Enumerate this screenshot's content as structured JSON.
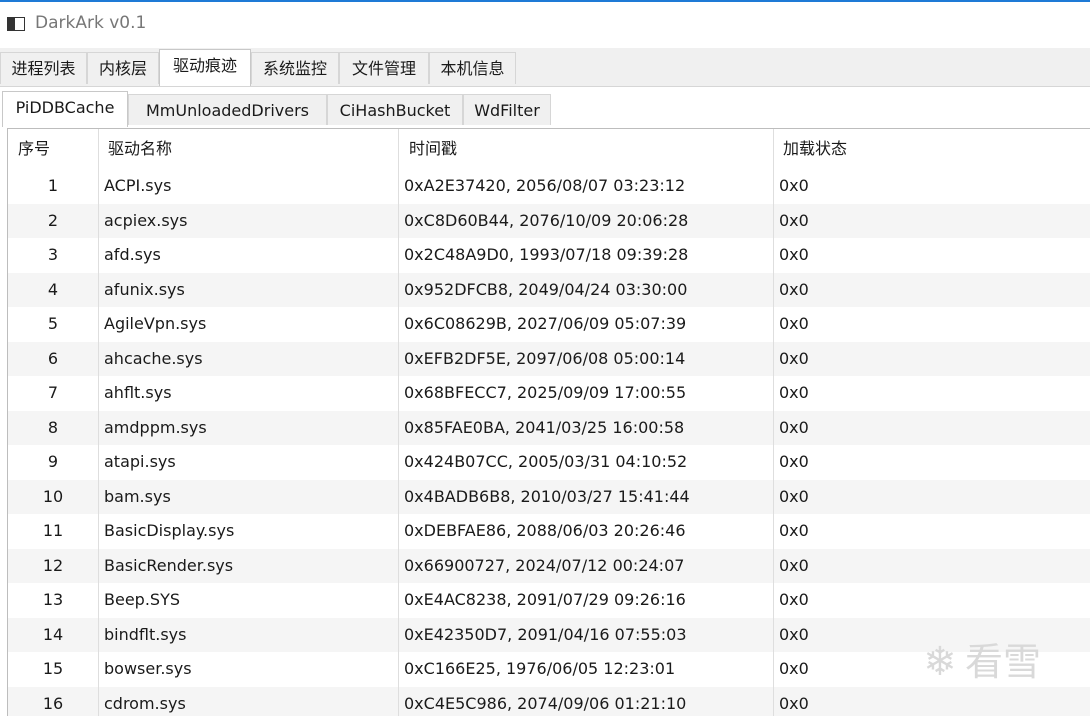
{
  "window": {
    "title": "DarkArk v0.1"
  },
  "main_tabs": [
    {
      "label": "进程列表",
      "active": false
    },
    {
      "label": "内核层",
      "active": false
    },
    {
      "label": "驱动痕迹",
      "active": true
    },
    {
      "label": "系统监控",
      "active": false
    },
    {
      "label": "文件管理",
      "active": false
    },
    {
      "label": "本机信息",
      "active": false
    }
  ],
  "sub_tabs": [
    {
      "label": "PiDDBCache",
      "active": true
    },
    {
      "label": "MmUnloadedDrivers",
      "active": false
    },
    {
      "label": "CiHashBucket",
      "active": false
    },
    {
      "label": "WdFilter",
      "active": false
    }
  ],
  "table": {
    "columns": [
      "序号",
      "驱动名称",
      "时间戳",
      "加载状态"
    ],
    "rows": [
      [
        "1",
        "ACPI.sys",
        "0xA2E37420, 2056/08/07 03:23:12",
        "0x0"
      ],
      [
        "2",
        "acpiex.sys",
        "0xC8D60B44, 2076/10/09 20:06:28",
        "0x0"
      ],
      [
        "3",
        "afd.sys",
        "0x2C48A9D0, 1993/07/18 09:39:28",
        "0x0"
      ],
      [
        "4",
        "afunix.sys",
        "0x952DFCB8, 2049/04/24 03:30:00",
        "0x0"
      ],
      [
        "5",
        "AgileVpn.sys",
        "0x6C08629B, 2027/06/09 05:07:39",
        "0x0"
      ],
      [
        "6",
        "ahcache.sys",
        "0xEFB2DF5E, 2097/06/08 05:00:14",
        "0x0"
      ],
      [
        "7",
        "ahflt.sys",
        "0x68BFECC7, 2025/09/09 17:00:55",
        "0x0"
      ],
      [
        "8",
        "amdppm.sys",
        "0x85FAE0BA, 2041/03/25 16:00:58",
        "0x0"
      ],
      [
        "9",
        "atapi.sys",
        "0x424B07CC, 2005/03/31 04:10:52",
        "0x0"
      ],
      [
        "10",
        "bam.sys",
        "0x4BADB6B8, 2010/03/27 15:41:44",
        "0x0"
      ],
      [
        "11",
        "BasicDisplay.sys",
        "0xDEBFAE86, 2088/06/03 20:26:46",
        "0x0"
      ],
      [
        "12",
        "BasicRender.sys",
        "0x66900727, 2024/07/12 00:24:07",
        "0x0"
      ],
      [
        "13",
        "Beep.SYS",
        "0xE4AC8238, 2091/07/29 09:26:16",
        "0x0"
      ],
      [
        "14",
        "bindflt.sys",
        "0xE42350D7, 2091/04/16 07:55:03",
        "0x0"
      ],
      [
        "15",
        "bowser.sys",
        "0xC166E25, 1976/06/05 12:23:01",
        "0x0"
      ],
      [
        "16",
        "cdrom.sys",
        "0xC4E5C986, 2074/09/06 01:21:10",
        "0x0"
      ]
    ]
  },
  "watermark": {
    "text": "看雪",
    "icon": "snowflake-icon"
  },
  "colors": {
    "accent": "#1e7ad6",
    "row_alt": "#f5f5f5"
  }
}
